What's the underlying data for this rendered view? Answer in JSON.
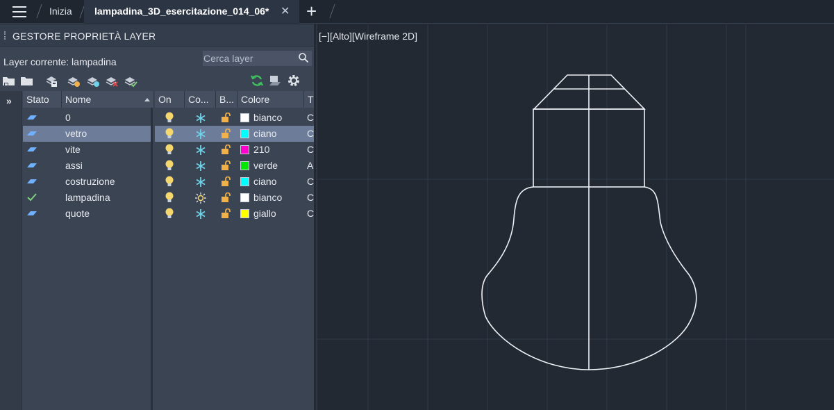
{
  "tabs": {
    "home_label": "Inizia",
    "active_label": "lampadina_3D_esercitazione_014_06*",
    "close_glyph": "✕",
    "add_glyph": "+"
  },
  "palette": {
    "title": "GESTORE PROPRIETÀ LAYER",
    "current_layer": "Layer corrente: lampadina",
    "search_placeholder": "Cerca layer",
    "expand_glyph": "»",
    "columns": {
      "stato": "Stato",
      "nome": "Nome",
      "on": "On",
      "congela": "Co...",
      "blocca": "B...",
      "colore": "Colore",
      "tipolinea": "T"
    },
    "layers": [
      {
        "name": "0",
        "current": false,
        "selected": false,
        "frozen": false,
        "color_name": "bianco",
        "color_hex": "#ffffff",
        "linetype_initial": "C"
      },
      {
        "name": "vetro",
        "current": false,
        "selected": true,
        "frozen": false,
        "color_name": "ciano",
        "color_hex": "#00ffff",
        "linetype_initial": "C"
      },
      {
        "name": "vite",
        "current": false,
        "selected": false,
        "frozen": false,
        "color_name": "210",
        "color_hex": "#ff00cc",
        "linetype_initial": "C"
      },
      {
        "name": "assi",
        "current": false,
        "selected": false,
        "frozen": false,
        "color_name": "verde",
        "color_hex": "#00e600",
        "linetype_initial": "A"
      },
      {
        "name": "costruzione",
        "current": false,
        "selected": false,
        "frozen": false,
        "color_name": "ciano",
        "color_hex": "#00ffff",
        "linetype_initial": "C"
      },
      {
        "name": "lampadina",
        "current": true,
        "selected": false,
        "frozen": false,
        "color_name": "bianco",
        "color_hex": "#ffffff",
        "linetype_initial": "C"
      },
      {
        "name": "quote",
        "current": false,
        "selected": false,
        "frozen": false,
        "color_name": "giallo",
        "color_hex": "#ffff00",
        "linetype_initial": "C"
      }
    ]
  },
  "viewport": {
    "label": "[−][Alto][Wireframe 2D]"
  },
  "colors": {
    "accent_selection": "#6d7d99",
    "bulb_icon": "#f5d76e",
    "snowflake": "#6fd3e8",
    "lock": "#f0b04a",
    "current_check": "#7ed07e",
    "refresh": "#3fbf5f"
  }
}
